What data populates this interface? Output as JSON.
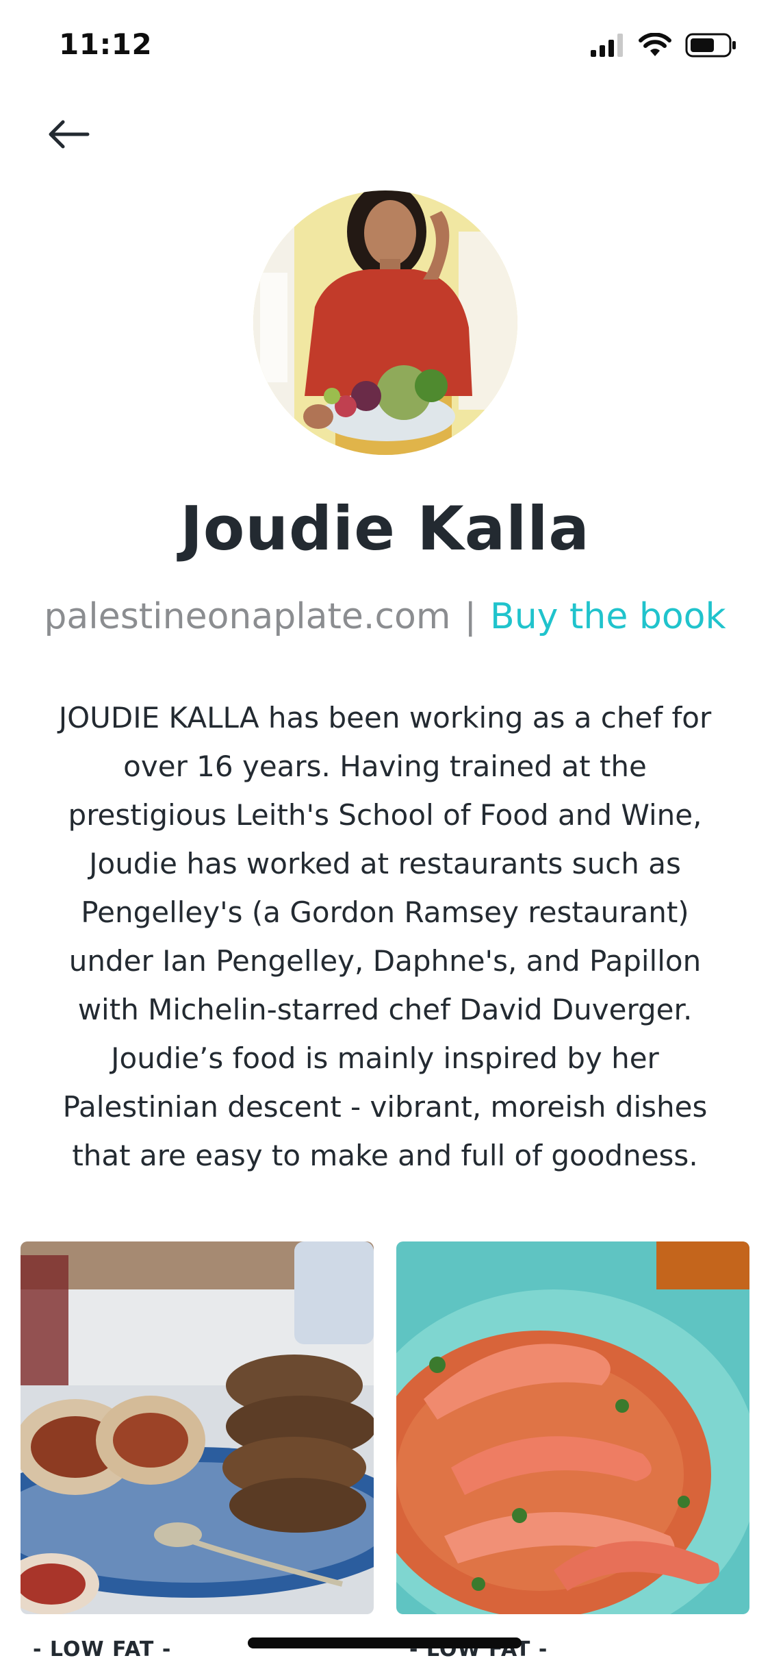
{
  "status_bar": {
    "time": "11:12",
    "icons": [
      "cellular-signal-icon",
      "wifi-icon",
      "battery-icon"
    ]
  },
  "nav": {
    "back_icon": "arrow-left-icon"
  },
  "profile": {
    "name": "Joudie Kalla",
    "website": "palestineonaplate.com",
    "separator": "|",
    "buy_link": "Buy the book",
    "bio": "JOUDIE KALLA has been working as a chef for over 16 years. Having trained at the prestigious Leith's School of Food and Wine, Joudie has worked at restaurants such as Pengelley's (a Gordon Ramsey restaurant) under Ian Pengelley, Daphne's, and Papillon with Michelin-starred chef David Duverger. Joudie’s food is mainly inspired by her Palestinian descent - vibrant, moreish dishes that are easy to make and full of goodness."
  },
  "recipes": [
    {
      "tag": "- LOW FAT -"
    },
    {
      "tag": "- LOW FAT -"
    }
  ],
  "colors": {
    "accent": "#20c3cc",
    "text_dark": "#232a31",
    "text_muted": "#8b8d90"
  }
}
